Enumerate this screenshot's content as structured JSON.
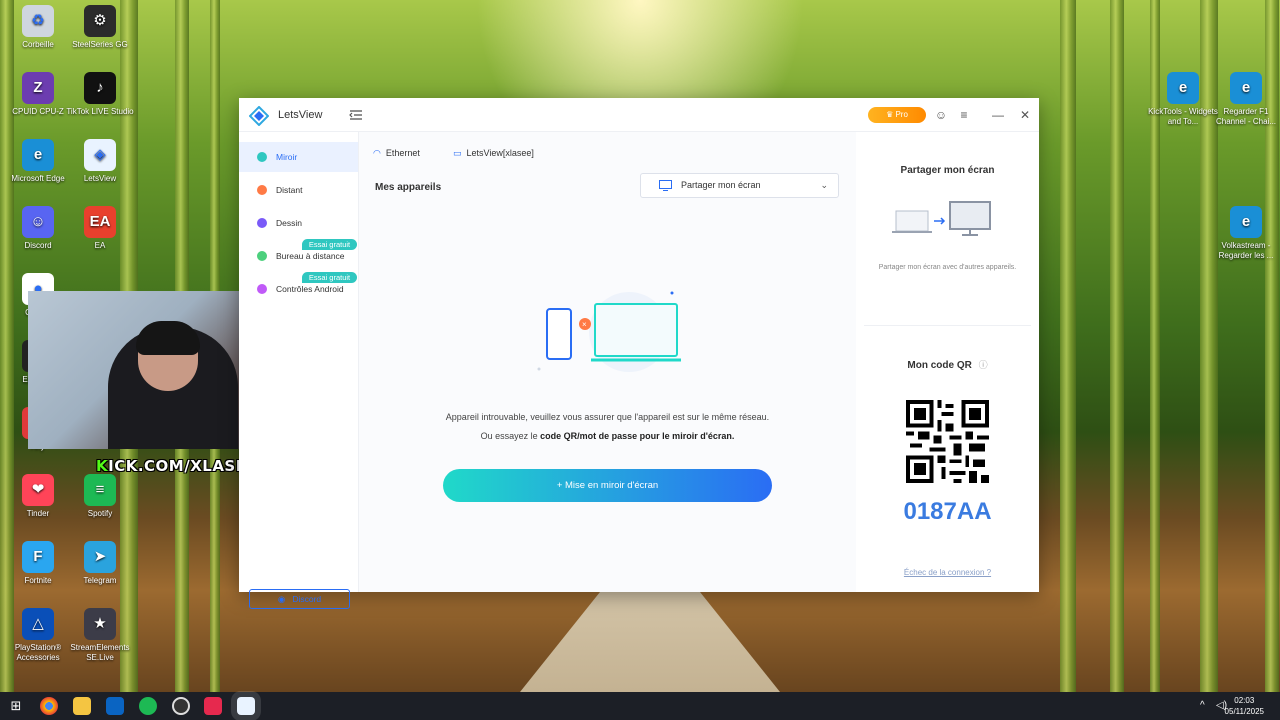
{
  "desktop": {
    "left_icons": [
      {
        "label": "Corbeille",
        "color": "#cfd6de",
        "glyph": "♻"
      },
      {
        "label": "SteelSeries GG",
        "color": "#2b2b2b",
        "glyph": "⚙"
      },
      {
        "label": "CPUID CPU-Z",
        "color": "#6c3db0",
        "glyph": "Z"
      },
      {
        "label": "TikTok LIVE Studio",
        "color": "#111111",
        "glyph": "♪"
      },
      {
        "label": "Microsoft Edge",
        "color": "#1a8fd6",
        "glyph": "e"
      },
      {
        "label": "LetsView",
        "color": "#e9f3ff",
        "glyph": "◈"
      },
      {
        "label": "Discord",
        "color": "#5865f2",
        "glyph": "☺"
      },
      {
        "label": "EA",
        "color": "#e8402d",
        "glyph": "EA"
      },
      {
        "label": "Google",
        "color": "#ffffff",
        "glyph": "●"
      },
      {
        "label": "Epic Lau",
        "color": "#222222",
        "glyph": "E"
      },
      {
        "label": "Any",
        "color": "#e03a3a",
        "glyph": "▶"
      },
      {
        "label": "Tinder",
        "color": "#ff4458",
        "glyph": "❤"
      },
      {
        "label": "Spotify",
        "color": "#1db954",
        "glyph": "≡"
      },
      {
        "label": "Fortnite",
        "color": "#2aa6f0",
        "glyph": "F"
      },
      {
        "label": "Telegram",
        "color": "#2aa3de",
        "glyph": "➤"
      },
      {
        "label": "PlayStation® Accessories",
        "color": "#0a4fb8",
        "glyph": "△"
      },
      {
        "label": "StreamElements SE.Live",
        "color": "#3c3c48",
        "glyph": "★"
      }
    ],
    "right_icons": [
      {
        "label": "KickTools - Widgets and To...",
        "color": "#1a8fd6",
        "glyph": "e"
      },
      {
        "label": "Regarder F1 Channel - Chai...",
        "color": "#1a8fd6",
        "glyph": "e"
      },
      {
        "label": "Volkastream - Regarder les ...",
        "color": "#1a8fd6",
        "glyph": "e"
      }
    ]
  },
  "stream_overlay": {
    "kick_prefix": "K",
    "kick_rest": "ICK.COM/XLASEE"
  },
  "app": {
    "title": "LetsView",
    "pro_label": "Pro",
    "sidebar": {
      "items": [
        {
          "label": "Miroir",
          "dot": "#2fc7c0",
          "active": true
        },
        {
          "label": "Distant",
          "dot": "#ff7a45",
          "active": false
        },
        {
          "label": "Dessin",
          "dot": "#7a5af8",
          "active": false
        },
        {
          "label": "Bureau à distance",
          "dot": "#4cd07d",
          "active": false
        },
        {
          "label": "Contrôles Android",
          "dot": "#c05af8",
          "active": false
        }
      ],
      "badge": "Essai gratuit",
      "discord": "Discord"
    },
    "main": {
      "tab_ethernet": "Ethernet",
      "tab_device": "LetsView[xlasee]",
      "section_title": "Mes appareils",
      "share_dropdown": "Partager mon écran",
      "message_1": "Appareil introuvable, veuillez vous assurer que l'appareil est sur le même réseau.",
      "message_2_prefix": "Ou essayez le ",
      "message_2_bold": "code QR/mot de passe pour le miroir d'écran.",
      "mirror_button": "+ Mise en miroir d'écran"
    },
    "right_panel": {
      "share_title": "Partager mon écran",
      "share_desc": "Partager mon écran avec d'autres appareils.",
      "qr_title": "Mon code QR",
      "code": "0187AA",
      "fail_link": "Échec de la connexion ?"
    }
  },
  "taskbar": {
    "time": "02:03",
    "date": "05/11/2025"
  }
}
